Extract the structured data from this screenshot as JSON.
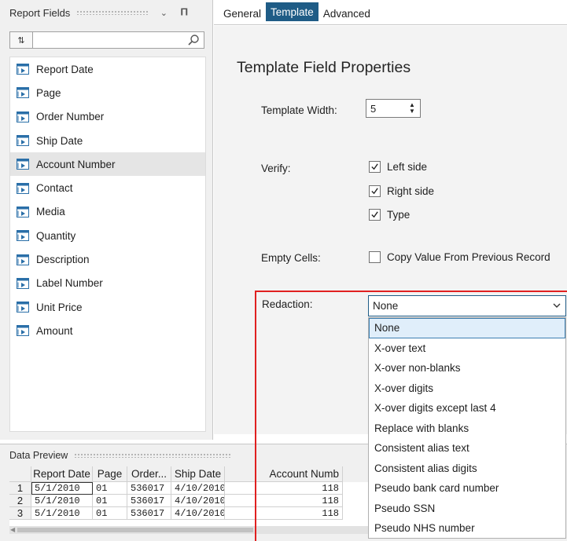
{
  "left_panel": {
    "title": "Report Fields",
    "pin_icon": "pin-icon",
    "dropdown_icon": "chevron-down-icon",
    "sort_button_glyph": "⇅",
    "search_placeholder": "",
    "fields": [
      {
        "label": "Report Date",
        "selected": false
      },
      {
        "label": "Page",
        "selected": false
      },
      {
        "label": "Order Number",
        "selected": false
      },
      {
        "label": "Ship Date",
        "selected": false
      },
      {
        "label": "Account Number",
        "selected": true
      },
      {
        "label": "Contact",
        "selected": false
      },
      {
        "label": "Media",
        "selected": false
      },
      {
        "label": "Quantity",
        "selected": false
      },
      {
        "label": "Description",
        "selected": false
      },
      {
        "label": "Label Number",
        "selected": false
      },
      {
        "label": "Unit Price",
        "selected": false
      },
      {
        "label": "Amount",
        "selected": false
      }
    ]
  },
  "tabs": [
    {
      "label": "General",
      "active": false
    },
    {
      "label": "Template",
      "active": true
    },
    {
      "label": "Advanced",
      "active": false
    }
  ],
  "properties": {
    "title": "Template Field Properties",
    "template_width_label": "Template Width:",
    "template_width_value": "5",
    "verify_label": "Verify:",
    "verify_options": [
      {
        "label": "Left side",
        "checked": true
      },
      {
        "label": "Right side",
        "checked": true
      },
      {
        "label": "Type",
        "checked": true
      }
    ],
    "empty_cells_label": "Empty Cells:",
    "empty_cells_option": {
      "label": "Copy Value From Previous Record",
      "checked": false
    },
    "redaction_label": "Redaction:",
    "redaction_value": "None",
    "redaction_options": [
      "None",
      "X-over text",
      "X-over non-blanks",
      "X-over digits",
      "X-over digits except last 4",
      "Replace with blanks",
      "Consistent alias text",
      "Consistent alias digits",
      "Pseudo bank card number",
      "Pseudo SSN",
      "Pseudo NHS number"
    ],
    "redaction_highlighted": "None"
  },
  "data_preview": {
    "title": "Data Preview",
    "columns": [
      "Report Date",
      "Page",
      "Order...",
      "Ship Date",
      "Account Numb"
    ],
    "rows": [
      {
        "n": "1",
        "cells": [
          "5/1/2010",
          "01",
          "536017",
          "4/10/2010",
          "118"
        ]
      },
      {
        "n": "2",
        "cells": [
          "5/1/2010",
          "01",
          "536017",
          "4/10/2010",
          "118"
        ]
      },
      {
        "n": "3",
        "cells": [
          "5/1/2010",
          "01",
          "536017",
          "4/10/2010",
          "118"
        ]
      }
    ]
  },
  "colors": {
    "accent": "#1f5c86",
    "highlight_frame": "#e02020",
    "selected_row": "#e5e5e5",
    "dropdown_highlight": "#e0eefa"
  }
}
